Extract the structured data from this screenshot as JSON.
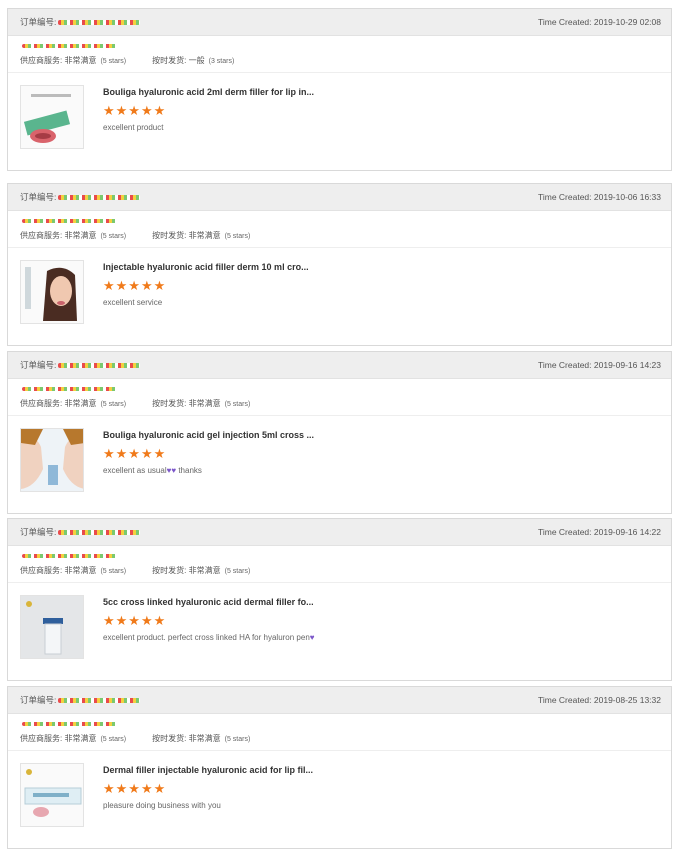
{
  "orders": [
    {
      "label": "订单编号:",
      "time": "Time Created: 2019-10-29 02:08",
      "supplier_label": "供应商服务:",
      "supplier_rating": "非常满意",
      "supplier_stars": "(5 stars)",
      "ship_label": "按时发货:",
      "ship_rating": "一般",
      "ship_stars": "(3 stars)",
      "title": "Bouliga hyaluronic acid 2ml derm filler for lip in...",
      "stars": "★★★★★",
      "comment": "excellent product",
      "thumb_icon": "syringe-box-icon"
    },
    {
      "label": "订单编号:",
      "time": "Time Created: 2019-10-06 16:33",
      "supplier_label": "供应商服务:",
      "supplier_rating": "非常满意",
      "supplier_stars": "(5 stars)",
      "ship_label": "按时发货:",
      "ship_rating": "非常满意",
      "ship_stars": "(5 stars)",
      "title": "Injectable hyaluronic acid filler derm 10 ml cro...",
      "stars": "★★★★★",
      "comment": "excellent service",
      "thumb_icon": "face-injection-icon"
    },
    {
      "label": "订单编号:",
      "time": "Time Created: 2019-09-16 14:23",
      "supplier_label": "供应商服务:",
      "supplier_rating": "非常满意",
      "supplier_stars": "(5 stars)",
      "ship_label": "按时发货:",
      "ship_rating": "非常满意",
      "ship_stars": "(5 stars)",
      "title": "Bouliga hyaluronic acid gel injection 5ml cross ...",
      "stars": "★★★★★",
      "comment": "excellent as usual",
      "comment_suffix": " thanks",
      "thumb_icon": "two-faces-icon"
    },
    {
      "label": "订单编号:",
      "time": "Time Created: 2019-09-16 14:22",
      "supplier_label": "供应商服务:",
      "supplier_rating": "非常满意",
      "supplier_stars": "(5 stars)",
      "ship_label": "按时发货:",
      "ship_rating": "非常满意",
      "ship_stars": "(5 stars)",
      "title": "5cc cross linked hyaluronic acid dermal filler fo...",
      "stars": "★★★★★",
      "comment": "excellent product. perfect cross linked HA for hyaluron pen",
      "thumb_icon": "vial-icon"
    },
    {
      "label": "订单编号:",
      "time": "Time Created: 2019-08-25 13:32",
      "supplier_label": "供应商服务:",
      "supplier_rating": "非常满意",
      "supplier_stars": "(5 stars)",
      "ship_label": "按时发货:",
      "ship_rating": "非常满意",
      "ship_stars": "(5 stars)",
      "title": "Dermal filler injectable hyaluronic acid for lip fil...",
      "stars": "★★★★★",
      "comment": "pleasure doing business with you",
      "thumb_icon": "syringe-package-icon"
    }
  ],
  "colors": {
    "star": "#f07a1a",
    "heart": "#7b56c9",
    "header_bg": "#eeeeee"
  }
}
